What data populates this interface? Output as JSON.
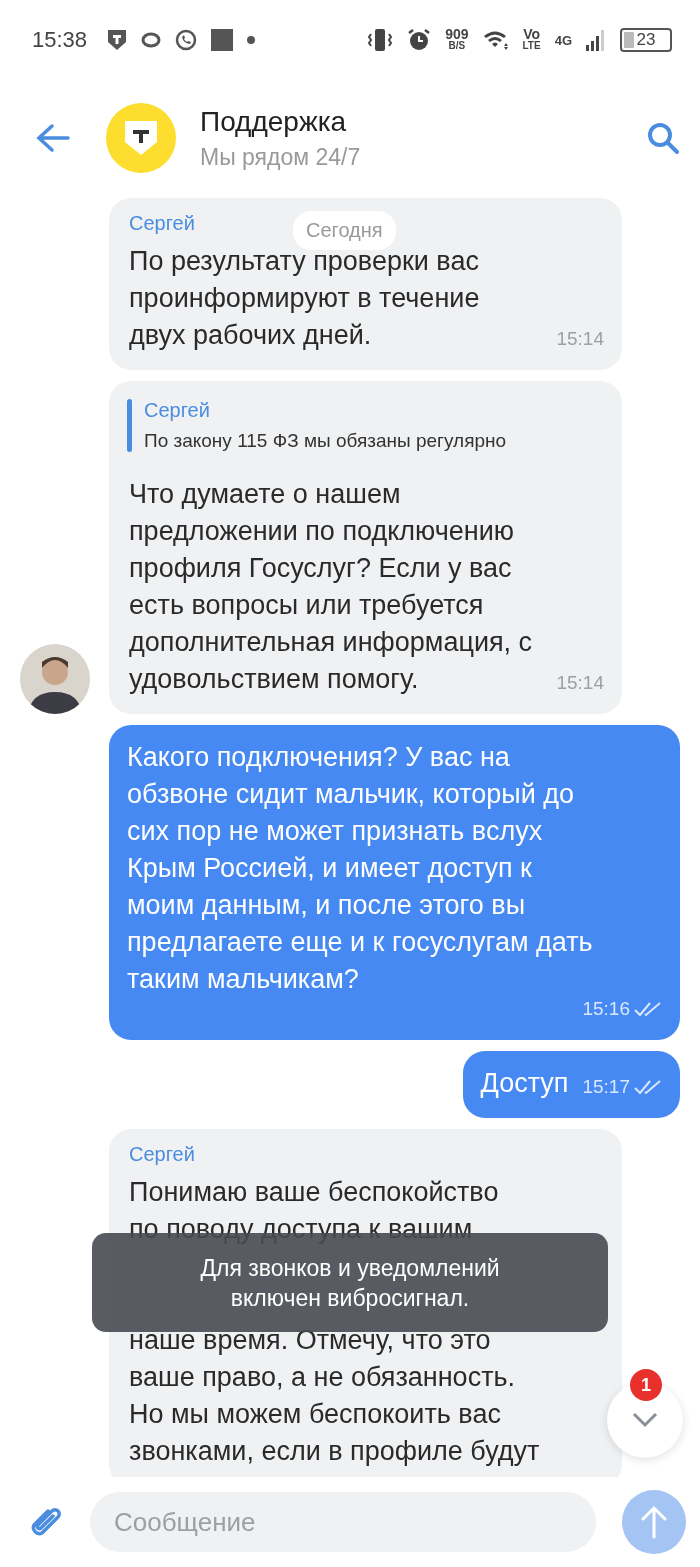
{
  "status_bar": {
    "time": "15:38",
    "speed": "909",
    "speed_unit": "B/S",
    "volte_top": "Vo",
    "volte_bottom": "LTE",
    "network": "4G",
    "battery": "23"
  },
  "header": {
    "title": "Поддержка",
    "subtitle": "Мы рядом 24/7"
  },
  "date_chip": "Сегодня",
  "messages": [
    {
      "kind": "incoming",
      "sender": "Сергей",
      "text": [
        "По результату проверки вас\nпроинформируют в течение\nдвух рабочих дней."
      ],
      "time": "15:14",
      "avatar": false
    },
    {
      "kind": "incoming",
      "reply": {
        "sender": "Сергей",
        "text": "По закону 115 ФЗ мы обязаны регулярно"
      },
      "text": [
        "Что думаете о нашем\nпредложении по подключению\nпрофиля Госуслуг? Если у вас\nесть вопросы или требуется\nдополнительная информация, с\nудовольствием помогу."
      ],
      "time": "15:14",
      "avatar": true
    },
    {
      "kind": "outgoing",
      "text": [
        "Какого подключения? У вас на\nобзвоне сидит мальчик, который до\nсих пор не может признать вслух\nКрым Россией, и имеет доступ к\nмоим данным, и после этого вы\nпредлагаете еще и к госуслугам дать\nтаким мальчикам?"
      ],
      "time": "15:16",
      "read": true
    },
    {
      "kind": "outgoing",
      "text": [
        "Доступ"
      ],
      "time": "15:17",
      "read": true
    },
    {
      "kind": "incoming",
      "sender": "Сергей",
      "text": [
        "Понимаю ваше беспокойство\nпо поводу доступа к вашим",
        "наше время. Отмечу, что это\nваше право, а не обязанность.\nНо мы можем беспокоить вас\nзвонками, если в профиле будут"
      ],
      "avatar": false
    }
  ],
  "toast": "Для звонков и уведомлений\nвключен вибросигнал.",
  "scroll_button": {
    "badge": "1"
  },
  "composer": {
    "placeholder": "Сообщение"
  }
}
